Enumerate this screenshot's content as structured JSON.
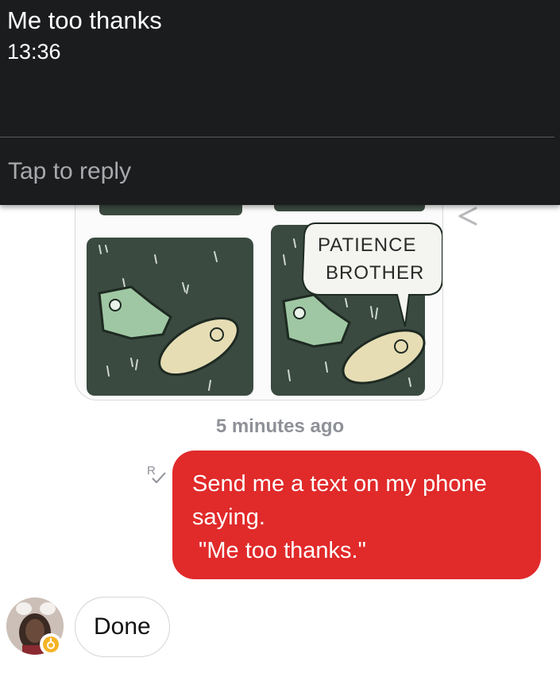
{
  "notification": {
    "message": "Me too thanks",
    "time": "13:36",
    "reply_placeholder": "Tap to reply"
  },
  "thread": {
    "comic_text": [
      "PATIENCE",
      "BROTHER"
    ],
    "timestamp": "5 minutes ago",
    "outgoing_message": {
      "lines": [
        "Send me a text on my phone",
        "saying.",
        " \"Me too thanks.\""
      ],
      "color": "#e12a2a"
    },
    "read_receipt_icon": "read-receipt-icon",
    "incoming_message": {
      "text": "Done"
    }
  },
  "icons": [
    "share-icon",
    "read-receipt-icon",
    "ok-hand-icon"
  ]
}
